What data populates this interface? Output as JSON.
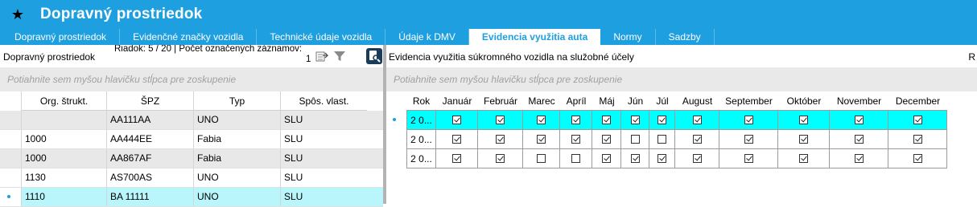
{
  "window": {
    "title": "Dopravný prostriedok",
    "star_icon": "star-icon"
  },
  "tabs": [
    {
      "label": "Dopravný prostriedok",
      "active": false
    },
    {
      "label": "Evidenčné značky vozidla",
      "active": false
    },
    {
      "label": "Technické údaje vozidla",
      "active": false
    },
    {
      "label": "Údaje k DMV",
      "active": false
    },
    {
      "label": "Evidencia využitia auta",
      "active": true
    },
    {
      "label": "Normy",
      "active": false
    },
    {
      "label": "Sadzby",
      "active": false
    }
  ],
  "left": {
    "title": "Dopravný prostriedok",
    "row_info": "Riadok: 5 / 20 | Počet označených záznamov:",
    "row_info_count": "1",
    "group_hint": "Potiahnite sem myšou hlavičku stĺpca pre zoskupenie",
    "columns": [
      "Org. štrukt.",
      "ŠPZ",
      "Typ",
      "Spôs. vlast."
    ],
    "rows": [
      {
        "org": "",
        "spz": "AA111AA",
        "typ": "UNO",
        "vlast": "SLU",
        "style": "grey"
      },
      {
        "org": "1000",
        "spz": "AA444EE",
        "typ": "Fabia",
        "vlast": "SLU",
        "style": "white"
      },
      {
        "org": "1000",
        "spz": "AA867AF",
        "typ": "Fabia",
        "vlast": "SLU",
        "style": "grey"
      },
      {
        "org": "1130",
        "spz": "AS700AS",
        "typ": "UNO",
        "vlast": "SLU",
        "style": "white"
      },
      {
        "org": "1110",
        "spz": "BA 11111",
        "typ": "UNO",
        "vlast": "SLU",
        "style": "selected"
      }
    ]
  },
  "right": {
    "title": "Evidencia využitia súkromného vozidla na služobné účely",
    "truncated_label": "R",
    "group_hint": "Potiahnite sem myšou hlavičku stĺpca pre zoskupenie",
    "columns": [
      "Rok",
      "Január",
      "Február",
      "Marec",
      "Apríl",
      "Máj",
      "Jún",
      "Júl",
      "August",
      "September",
      "Október",
      "November",
      "December"
    ],
    "rows": [
      {
        "rok": "2 0...",
        "selected": true,
        "months": [
          true,
          true,
          true,
          true,
          true,
          true,
          true,
          true,
          true,
          true,
          true,
          true
        ]
      },
      {
        "rok": "2 0...",
        "selected": false,
        "months": [
          true,
          true,
          true,
          true,
          true,
          false,
          false,
          true,
          true,
          true,
          true,
          true
        ]
      },
      {
        "rok": "2 0...",
        "selected": false,
        "months": [
          true,
          true,
          false,
          false,
          true,
          true,
          true,
          true,
          true,
          true,
          true,
          true
        ]
      }
    ]
  }
}
